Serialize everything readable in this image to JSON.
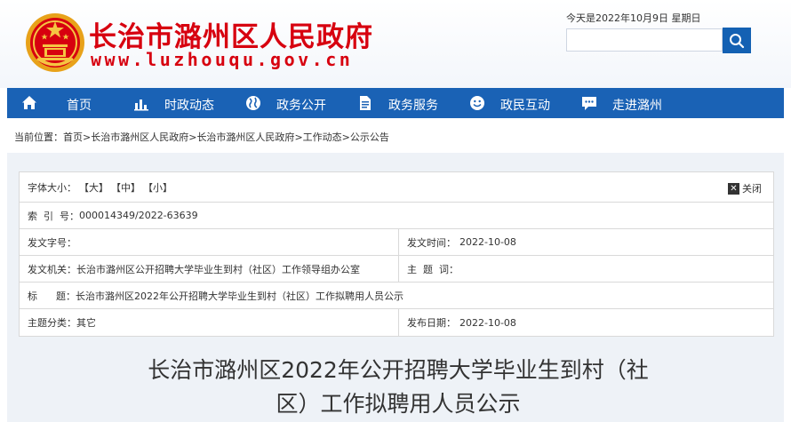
{
  "header": {
    "site_title": "长治市潞州区人民政府",
    "site_url": "www.luzhouqu.gov.cn",
    "date_text": "今天是2022年10月9日 星期日",
    "search_placeholder": ""
  },
  "nav": {
    "items": [
      {
        "label": "首页",
        "icon": "home-icon"
      },
      {
        "label": "时政动态",
        "icon": "bar-chart-icon"
      },
      {
        "label": "政务公开",
        "icon": "globe-icon"
      },
      {
        "label": "政务服务",
        "icon": "document-icon"
      },
      {
        "label": "政民互动",
        "icon": "smiley-icon"
      },
      {
        "label": "走进潞州",
        "icon": "chat-icon"
      }
    ]
  },
  "breadcrumb": {
    "prefix": "当前位置：",
    "items": [
      "首页",
      "长治市潞州区人民政府",
      "长治市潞州区人民政府",
      "工作动态",
      "公示公告"
    ],
    "separator": ">"
  },
  "meta": {
    "font_size_label": "字体大小：",
    "font_sizes": [
      "【大】",
      "【中】",
      "【小】"
    ],
    "close_label": "关闭",
    "index_label": "索  引  号：",
    "index_value": "000014349/2022-63639",
    "doc_number_label": "发文字号：",
    "doc_number_value": "",
    "issue_time_label": "发文时间：",
    "issue_time_value": "2022-10-08",
    "issuer_label": "发文机关：",
    "issuer_value": "长治市潞州区公开招聘大学毕业生到村（社区）工作领导组办公室",
    "subject_label": "主  题  词：",
    "subject_value": "",
    "title_label": "标      题：",
    "title_value": "长治市潞州区2022年公开招聘大学毕业生到村（社区）工作拟聘用人员公示",
    "category_label": "主题分类：",
    "category_value": "其它",
    "publish_date_label": "发布日期：",
    "publish_date_value": "2022-10-08"
  },
  "article": {
    "title_line1": "长治市潞州区2022年公开招聘大学毕业生到村（社",
    "title_line2": "区）工作拟聘用人员公示"
  },
  "colors": {
    "brand_red": "#d7000f",
    "nav_blue": "#1a62b5",
    "search_blue": "#1461b3",
    "content_bg": "#eef2f7"
  }
}
